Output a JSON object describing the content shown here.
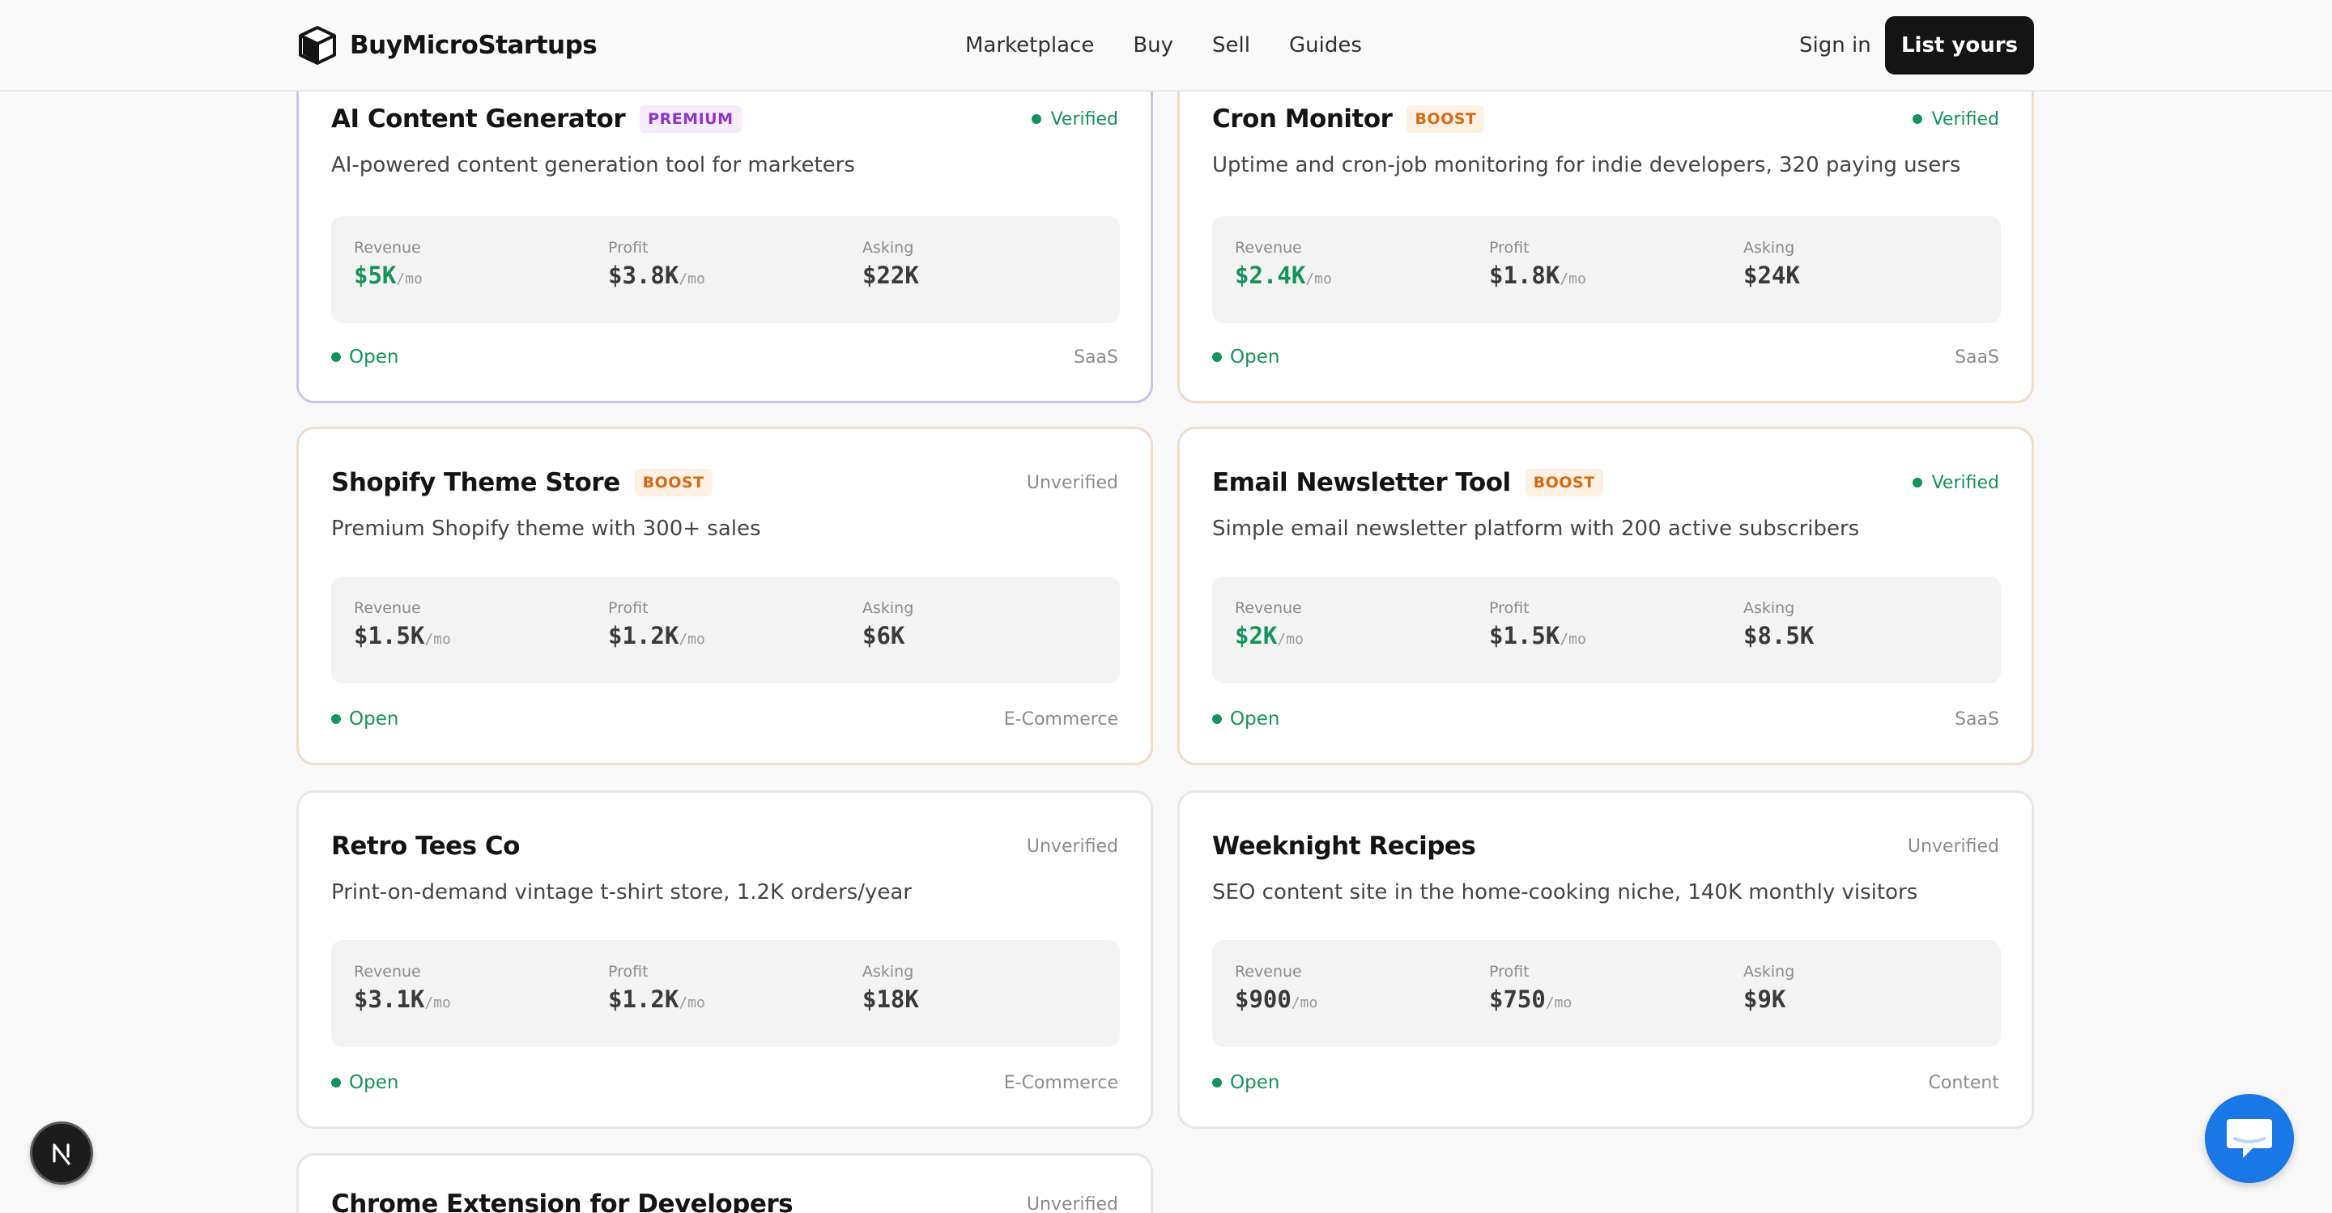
{
  "header": {
    "brand": "BuyMicroStartups",
    "nav": [
      "Marketplace",
      "Buy",
      "Sell",
      "Guides"
    ],
    "sign_in": "Sign in",
    "list_button": "List yours"
  },
  "metric_labels": {
    "revenue": "Revenue",
    "profit": "Profit",
    "asking": "Asking"
  },
  "unit": "/mo",
  "listings": [
    {
      "title": "AI Content Generator",
      "badge": "PREMIUM",
      "tier": "premium",
      "verification": "Verified",
      "description": "AI-powered content generation tool for marketers",
      "revenue": "$5K",
      "profit": "$3.8K",
      "asking": "$22K",
      "status": "Open",
      "category": "SaaS"
    },
    {
      "title": "Cron Monitor",
      "badge": "BOOST",
      "tier": "boost",
      "verification": "Verified",
      "description": "Uptime and cron-job monitoring for indie developers, 320 paying users",
      "revenue": "$2.4K",
      "profit": "$1.8K",
      "asking": "$24K",
      "status": "Open",
      "category": "SaaS"
    },
    {
      "title": "Shopify Theme Store",
      "badge": "BOOST",
      "tier": "boost",
      "verification": "Unverified",
      "description": "Premium Shopify theme with 300+ sales",
      "revenue": "$1.5K",
      "profit": "$1.2K",
      "asking": "$6K",
      "status": "Open",
      "category": "E-Commerce"
    },
    {
      "title": "Email Newsletter Tool",
      "badge": "BOOST",
      "tier": "boost",
      "verification": "Verified",
      "description": "Simple email newsletter platform with 200 active subscribers",
      "revenue": "$2K",
      "profit": "$1.5K",
      "asking": "$8.5K",
      "status": "Open",
      "category": "SaaS"
    },
    {
      "title": "Retro Tees Co",
      "badge": "",
      "tier": "standard",
      "verification": "Unverified",
      "description": "Print-on-demand vintage t-shirt store, 1.2K orders/year",
      "revenue": "$3.1K",
      "profit": "$1.2K",
      "asking": "$18K",
      "status": "Open",
      "category": "E-Commerce"
    },
    {
      "title": "Weeknight Recipes",
      "badge": "",
      "tier": "standard",
      "verification": "Unverified",
      "description": "SEO content site in the home-cooking niche, 140K monthly visitors",
      "revenue": "$900",
      "profit": "$750",
      "asking": "$9K",
      "status": "Open",
      "category": "Content"
    },
    {
      "title": "Chrome Extension for Developers",
      "badge": "",
      "tier": "standard",
      "verification": "Unverified",
      "description": "",
      "revenue": "",
      "profit": "",
      "asking": "",
      "status": "",
      "category": ""
    }
  ],
  "colors": {
    "accent_green": "#14935a",
    "premium_border": "#c9c1f0",
    "boost_border": "#f1dcc4",
    "chat_blue": "#1a77e6"
  },
  "icons": {
    "brand_logo": "cube-logo-icon",
    "dev_overlay": "next-n-icon",
    "chat": "chat-bubble-icon"
  }
}
